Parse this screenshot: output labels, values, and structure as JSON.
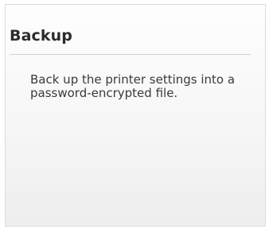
{
  "tile": {
    "title": "Backup",
    "description": "Back up the printer settings into a password-encrypted file."
  }
}
